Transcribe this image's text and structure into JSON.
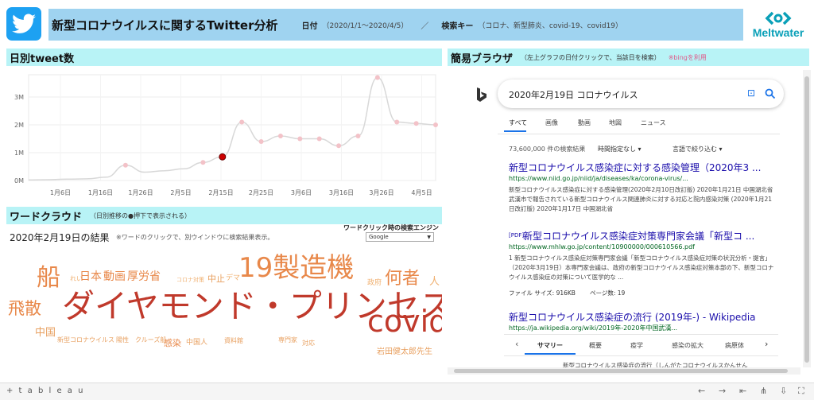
{
  "header": {
    "title": "新型コロナウイルスに関するTwitter分析",
    "date_label": "日付",
    "date_value": "（2020/1/1～2020/4/5）",
    "separator": "／",
    "keyword_label": "検索キー",
    "keyword_value": "（コロナ、新型肺炎、covid-19、covid19）",
    "brand": "Meltwater"
  },
  "chart_section": {
    "title": "日別tweet数"
  },
  "chart_data": {
    "type": "line",
    "title": "日別tweet数",
    "x": [
      "1/1",
      "1/6",
      "1/11",
      "1/16",
      "1/21",
      "1/26",
      "1/31",
      "2/5",
      "2/10",
      "2/15",
      "2/19",
      "2/25",
      "3/1",
      "3/6",
      "3/11",
      "3/16",
      "3/21",
      "3/26",
      "3/28",
      "3/31",
      "4/3",
      "4/5"
    ],
    "values": [
      0.02,
      0.03,
      0.05,
      0.06,
      0.12,
      0.55,
      0.3,
      0.35,
      0.42,
      0.65,
      0.85,
      2.1,
      1.4,
      1.6,
      1.5,
      1.5,
      1.25,
      1.6,
      3.7,
      2.1,
      2.05,
      2.0
    ],
    "x_ticks": [
      "1月6日",
      "1月16日",
      "1月26日",
      "2月5日",
      "2月15日",
      "2月25日",
      "3月6日",
      "3月16日",
      "3月26日",
      "4月5日"
    ],
    "y_ticks": [
      "0M",
      "1M",
      "2M",
      "3M"
    ],
    "ylim": [
      0,
      3.8
    ],
    "selected": "2/19",
    "grid": true
  },
  "wordcloud_section": {
    "title": "ワードクラウド",
    "subtitle": "（日別推移の●押下で表示される）",
    "result_label": "2020年2月19日の結果",
    "note": "※ワードのクリックで、別ウインドウに検索結果表示。",
    "engine_label": "ワードクリック時の検索エンジン",
    "engine_selected": "Google",
    "words": [
      {
        "text": "ダイヤモンド・プリンセス",
        "color": "#c0392b"
      },
      {
        "text": "19製造機",
        "color": "#e8884a"
      },
      {
        "text": "covid",
        "color": "#c0392b"
      },
      {
        "text": "船",
        "color": "#e8884a"
      },
      {
        "text": "何者",
        "color": "#e8884a"
      },
      {
        "text": "飛散",
        "color": "#e8884a"
      },
      {
        "text": "日本",
        "color": "#e8884a"
      },
      {
        "text": "動画",
        "color": "#e8884a"
      },
      {
        "text": "厚労省",
        "color": "#e8884a"
      },
      {
        "text": "れい",
        "color": "#f0b070"
      },
      {
        "text": "コロナ対策",
        "color": "#f0b070"
      },
      {
        "text": "中止",
        "color": "#e8a060"
      },
      {
        "text": "デマ",
        "color": "#f0b070"
      },
      {
        "text": "政府",
        "color": "#f0b070"
      },
      {
        "text": "人",
        "color": "#f0b070"
      },
      {
        "text": "中国",
        "color": "#e8a060"
      },
      {
        "text": "新型コロナウイルス",
        "color": "#e8a060"
      },
      {
        "text": "陽性",
        "color": "#e8a060"
      },
      {
        "text": "クルーズ船",
        "color": "#e8a060"
      },
      {
        "text": "感染",
        "color": "#e8884a"
      },
      {
        "text": "中国人",
        "color": "#e8a060"
      },
      {
        "text": "資料館",
        "color": "#e8a060"
      },
      {
        "text": "専門家",
        "color": "#e8a060"
      },
      {
        "text": "対応",
        "color": "#e8a060"
      },
      {
        "text": "岩田健太郎先生",
        "color": "#e8a060"
      }
    ]
  },
  "browser_section": {
    "title": "簡易ブラウザ",
    "subtitle": "（左上グラフの日付クリックで、当該日を検索）",
    "note": "※bingを利用",
    "query": "2020年2月19日 コロナウイルス",
    "tabs": [
      "すべて",
      "画像",
      "動画",
      "地図",
      "ニュース"
    ],
    "result_count": "73,600,000 件の検索結果",
    "filter_time": "時間指定なし",
    "filter_lang": "言語で絞り込む",
    "results": [
      {
        "title": "新型コロナウイルス感染症に対する感染管理（2020年3 ...",
        "url": "https://www.niid.go.jp/niid/ja/diseases/ka/corona-virus/...",
        "desc": "新型コロナウイルス感染症に対する感染管理(2020年2月10日改訂版) 2020年1月21日 中国湖北省武漢市で報告されている新型コロナウイルス関連肺炎に対する対応と院内感染対策 (2020年1月21日改訂版) 2020年1月17日 中国湖北省"
      },
      {
        "badge": "[PDF]",
        "title": "新型コロナウイルス感染症対策専門家会議「新型コ ...",
        "url": "https://www.mhlw.go.jp/content/10900000/000610566.pdf",
        "desc": "1 新型コロナウイルス感染症対策専門家会議「新型コロナウイルス感染症対策の状況分析・提言」（2020年3月19日）本専門家会議は、政府の新型コロナウイルス感染症対策本部の下、新型コロナウイルス感染症の対策について医学的な ...",
        "meta1": "ファイル サイズ: 916KB",
        "meta2": "ページ数: 19"
      },
      {
        "title": "新型コロナウイルス感染症の流行 (2019年-) - Wikipedia",
        "url": "https://ja.wikipedia.org/wiki/2019年-2020年中国武漢...",
        "subtabs": [
          "サマリー",
          "概要",
          "疫学",
          "感染の拡大",
          "病原体"
        ],
        "snippet": "新型コロナウイルス感染症の流行（しんがたコロナウイルスかんせん"
      }
    ]
  },
  "footer": {
    "brand": "+ t a b l e a u"
  }
}
